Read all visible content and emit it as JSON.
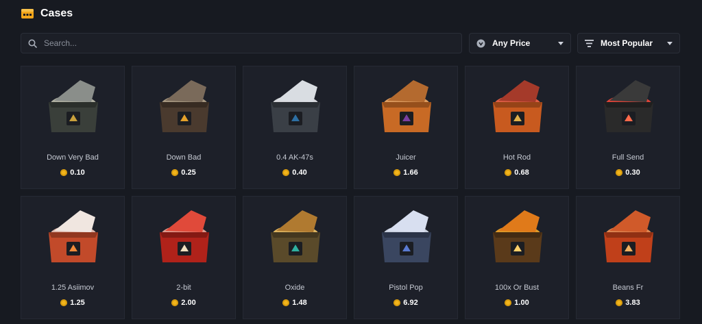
{
  "header": {
    "title": "Cases",
    "icon": "cases-icon",
    "accent": "#f2a51a"
  },
  "search": {
    "placeholder": "Search...",
    "value": ""
  },
  "filters": {
    "price": {
      "selected": "Any Price",
      "icon": "price-icon"
    },
    "sort": {
      "selected": "Most Popular",
      "icon": "sort-icon"
    }
  },
  "cases": [
    {
      "name": "Down Very Bad",
      "price": "0.10",
      "lid": "#8a8e8a",
      "body": "#3a3f3a",
      "glow": "#c9c9b6",
      "emblem": "#c9a03c"
    },
    {
      "name": "Down Bad",
      "price": "0.25",
      "lid": "#7a6a5a",
      "body": "#4a3a2e",
      "glow": "#bfae90",
      "emblem": "#e3a02a"
    },
    {
      "name": "0.4 AK-47s",
      "price": "0.40",
      "lid": "#d9dde2",
      "body": "#3a3f46",
      "glow": "#f4f6f8",
      "emblem": "#2d6fa3"
    },
    {
      "name": "Juicer",
      "price": "1.66",
      "lid": "#b46a2f",
      "body": "#c86a25",
      "glow": "#ffb36a",
      "emblem": "#7a3fa0"
    },
    {
      "name": "Hot Rod",
      "price": "0.68",
      "lid": "#a53a2a",
      "body": "#c85a1f",
      "glow": "#ff6a4a",
      "emblem": "#e0b04a"
    },
    {
      "name": "Full Send",
      "price": "0.30",
      "lid": "#3a3a3a",
      "body": "#2a2a2a",
      "glow": "#ff4a3a",
      "emblem": "#ff6a4a"
    },
    {
      "name": "1.25 Asiimov",
      "price": "1.25",
      "lid": "#f0e6e0",
      "body": "#c24a2a",
      "glow": "#ffd0c0",
      "emblem": "#f08a3a"
    },
    {
      "name": "2-bit",
      "price": "2.00",
      "lid": "#e04a3a",
      "body": "#b0221a",
      "glow": "#ffb0a0",
      "emblem": "#f0e0c0"
    },
    {
      "name": "Oxide",
      "price": "1.48",
      "lid": "#b07a30",
      "body": "#5a4a2a",
      "glow": "#ffcf6a",
      "emblem": "#2fb0a0"
    },
    {
      "name": "Pistol Pop",
      "price": "6.92",
      "lid": "#d8dff0",
      "body": "#3a4660",
      "glow": "#e8f0ff",
      "emblem": "#5a7ad0"
    },
    {
      "name": "100x Or Bust",
      "price": "1.00",
      "lid": "#e07a1a",
      "body": "#5a3a1a",
      "glow": "#ffb02a",
      "emblem": "#ffd06a"
    },
    {
      "name": "Beans Fr",
      "price": "3.83",
      "lid": "#d05a2a",
      "body": "#c0401a",
      "glow": "#ff9a5a",
      "emblem": "#f0b060"
    }
  ]
}
